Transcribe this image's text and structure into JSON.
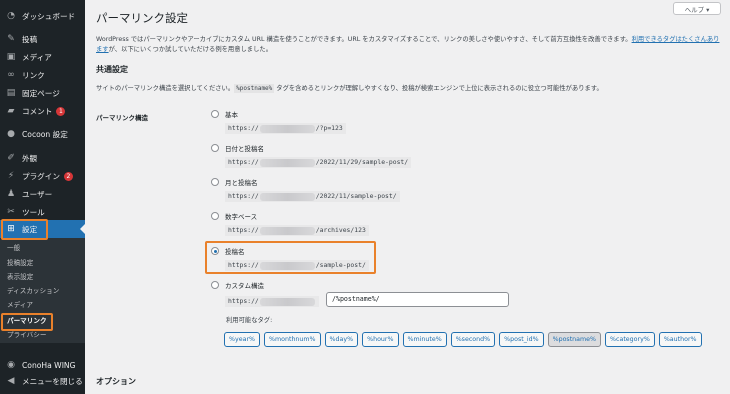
{
  "sidebar": {
    "items": [
      {
        "label": "ダッシュボード",
        "icon": "dashboard-icon"
      },
      {
        "label": "投稿",
        "icon": "pin-icon"
      },
      {
        "label": "メディア",
        "icon": "media-icon"
      },
      {
        "label": "リンク",
        "icon": "link-icon"
      },
      {
        "label": "固定ページ",
        "icon": "page-icon"
      },
      {
        "label": "コメント",
        "icon": "comment-icon",
        "badge": "1"
      },
      {
        "label": "Cocoon 設定",
        "icon": "cocoon-icon"
      },
      {
        "label": "外観",
        "icon": "brush-icon"
      },
      {
        "label": "プラグイン",
        "icon": "plugin-icon",
        "badge": "2"
      },
      {
        "label": "ユーザー",
        "icon": "user-icon"
      },
      {
        "label": "ツール",
        "icon": "wrench-icon"
      },
      {
        "label": "設定",
        "icon": "settings-icon",
        "active": true
      }
    ],
    "submenu": [
      "一般",
      "投稿設定",
      "表示設定",
      "ディスカッション",
      "メディア",
      "パーマリンク",
      "プライバシー"
    ],
    "bottom": [
      {
        "label": "ConoHa WING",
        "icon": "conoha-icon"
      },
      {
        "label": "メニューを閉じる",
        "icon": "collapse-icon"
      }
    ]
  },
  "help_button": "ヘルプ ▾",
  "page_title": "パーマリンク設定",
  "description": {
    "text": "WordPress ではパーマリンクやアーカイブにカスタム URL 構造を使うことができます。URL をカスタマイズすることで、リンクの美しさや使いやすさ、そして前方互換性を改善できます。",
    "link": "利用できるタグはたくさんあります",
    "after": "が、以下にいくつか試していただける例を用意しました。"
  },
  "common": {
    "heading": "共通設定",
    "desc_before": "サイトのパーマリンク構造を選択してください。",
    "desc_code": "%postname%",
    "desc_after": " タグを含めるとリンクが理解しやすくなり、投稿が検索エンジンで上位に表示されるのに役立つ可能性があります。"
  },
  "permalink_label": "パーマリンク構造",
  "options": [
    {
      "label": "基本",
      "prefix": "https://",
      "suffix": "/?p=123",
      "checked": false
    },
    {
      "label": "日付と投稿名",
      "prefix": "https://",
      "suffix": "/2022/11/29/sample-post/",
      "checked": false
    },
    {
      "label": "月と投稿名",
      "prefix": "https://",
      "suffix": "/2022/11/sample-post/",
      "checked": false
    },
    {
      "label": "数字ベース",
      "prefix": "https://",
      "suffix": "/archives/123",
      "checked": false
    },
    {
      "label": "投稿名",
      "prefix": "https://",
      "suffix": "/sample-post/",
      "checked": true
    },
    {
      "label": "カスタム構造",
      "prefix": "https://",
      "suffix": "",
      "checked": false
    }
  ],
  "custom_value": "/%postname%/",
  "available_tags_label": "利用可能なタグ:",
  "tags": [
    "%year%",
    "%monthnum%",
    "%day%",
    "%hour%",
    "%minute%",
    "%second%",
    "%post_id%",
    "%postname%",
    "%category%",
    "%author%"
  ],
  "selected_tag": "%postname%",
  "options_heading": "オプション",
  "colors": {
    "accent": "#2271b1",
    "highlight": "#e9812b",
    "sidebar": "#1d2327",
    "badge": "#d63638"
  }
}
